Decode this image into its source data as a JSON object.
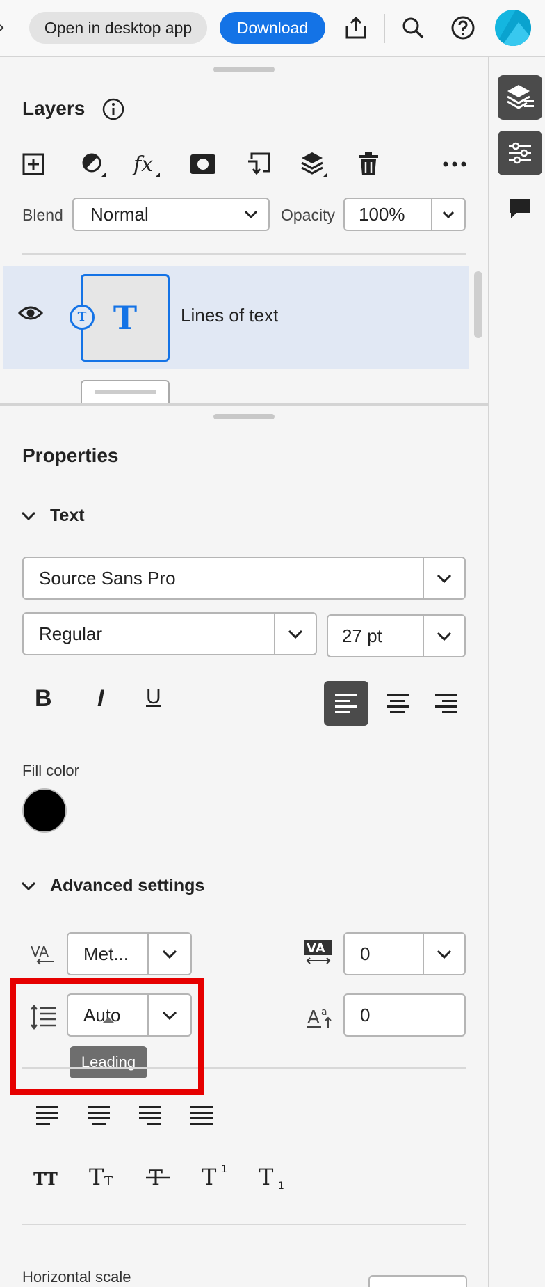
{
  "topbar": {
    "open_desktop_label": "Open in desktop app",
    "download_label": "Download",
    "avatar_color": "#14b6e0"
  },
  "layers": {
    "title": "Layers",
    "blend_label": "Blend",
    "blend_value": "Normal",
    "opacity_label": "Opacity",
    "opacity_value": "100%",
    "layer_name": "Lines of text",
    "thumb_glyph": "T",
    "badge_glyph": "T"
  },
  "properties": {
    "title": "Properties",
    "text_section": "Text",
    "font_family": "Source Sans Pro",
    "font_style": "Regular",
    "font_size": "27 pt",
    "bold_glyph": "B",
    "italic_glyph": "I",
    "underline_glyph": "U",
    "fill_label": "Fill color",
    "fill_color": "#000000",
    "advanced_section": "Advanced settings",
    "kerning_value": "Met...",
    "tracking_value": "0",
    "leading_value": "Auto",
    "baseline_value": "0",
    "tooltip": "Leading",
    "horizontal_scale_label": "Horizontal scale"
  },
  "colors": {
    "accent": "#1473e6",
    "selection": "#e1e8f4",
    "highlight_box": "#e60000"
  }
}
